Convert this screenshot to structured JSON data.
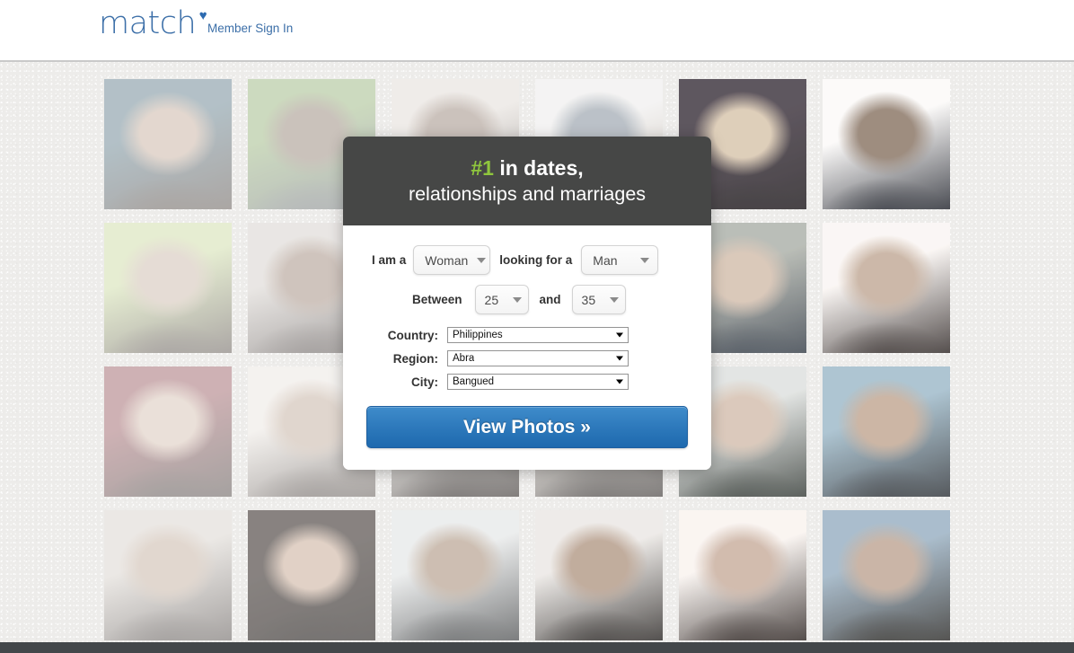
{
  "header": {
    "logo_text": "match",
    "logo_heart_icon": "heart-icon",
    "signin_label": "Member Sign In"
  },
  "modal": {
    "headline_hash": "#1",
    "headline_rest": " in dates,",
    "headline_line2": "relationships and marriages",
    "accent_color": "#8fc63d",
    "header_bg": "#464746",
    "gender_row": {
      "label_i_am_a": "I am a",
      "self_value": "Woman",
      "label_looking_for_a": "looking for a",
      "target_value": "Man"
    },
    "age_row": {
      "label_between": "Between",
      "age_min": "25",
      "label_and": "and",
      "age_max": "35"
    },
    "location": [
      {
        "label": "Country:",
        "value": "Philippines"
      },
      {
        "label": "Region:",
        "value": "Abra"
      },
      {
        "label": "City:",
        "value": "Bangued"
      }
    ],
    "cta_label": "View Photos »",
    "cta_color": "#2f7bbd"
  },
  "photo_grid": {
    "columns": 6,
    "rows": 4,
    "tiles": [
      {
        "name": "photo-r1c1",
        "wash": "wash-hi",
        "c1": "#2f6e8e",
        "c2": "#c89c7c",
        "c3": "#3a2a22"
      },
      {
        "name": "photo-r1c2",
        "wash": "wash-hi",
        "c1": "#6fae3f",
        "c2": "#8a6a52",
        "c3": "#4b5a62"
      },
      {
        "name": "photo-r1c3",
        "wash": "wash-hi",
        "c1": "#d8cfc6",
        "c2": "#8d6a54",
        "c3": "#3b2a22"
      },
      {
        "name": "photo-r1c4",
        "wash": "wash-hi",
        "c1": "#dfe0e2",
        "c2": "#4f6d8c",
        "c3": "#93724f"
      },
      {
        "name": "photo-r1c5",
        "wash": "wash-lo",
        "c1": "#3a2b3d",
        "c2": "#d8b98d",
        "c3": "#1d161c"
      },
      {
        "name": "photo-r1c6",
        "wash": "wash-lo",
        "c1": "#efeeec",
        "c2": "#8c6a4d",
        "c3": "#1b2230"
      },
      {
        "name": "photo-r2c1",
        "wash": "wash-hi",
        "c1": "#b6d96a",
        "c2": "#caa98c",
        "c3": "#3c2e26"
      },
      {
        "name": "photo-r2c2",
        "wash": "wash-hi",
        "c1": "#c9c2bb",
        "c2": "#9a6f55",
        "c3": "#2f2220"
      },
      {
        "name": "photo-r2c3",
        "wash": "wash-md",
        "c1": "#cfc6bd",
        "c2": "#a07a5e",
        "c3": "#332522"
      },
      {
        "name": "photo-r2c4",
        "wash": "wash-md",
        "c1": "#cbd2d6",
        "c2": "#9b7a5e",
        "c3": "#2a2420"
      },
      {
        "name": "photo-r2c5",
        "wash": "wash-lo",
        "c1": "#9fa89a",
        "c2": "#d5b192",
        "c3": "#2b3b4c"
      },
      {
        "name": "photo-r2c6",
        "wash": "wash-lo",
        "c1": "#efe9e4",
        "c2": "#c59d7c",
        "c3": "#2e2320"
      },
      {
        "name": "photo-r3c1",
        "wash": "wash-hi",
        "c1": "#b03a4a",
        "c2": "#d7b095",
        "c3": "#2b1f1c"
      },
      {
        "name": "photo-r3c2",
        "wash": "wash-hi",
        "c1": "#e3dcd4",
        "c2": "#c09a7c",
        "c3": "#33251f"
      },
      {
        "name": "photo-r3c3",
        "wash": "wash-md",
        "c1": "#dcd6cf",
        "c2": "#b08a6c",
        "c3": "#2d2220"
      },
      {
        "name": "photo-r3c4",
        "wash": "wash-md",
        "c1": "#d9cfc4",
        "c2": "#b7916f",
        "c3": "#2b2220"
      },
      {
        "name": "photo-r3c5",
        "wash": "wash-lo",
        "c1": "#cfd6d2",
        "c2": "#d6b294",
        "c3": "#2d3a32"
      },
      {
        "name": "photo-r3c6",
        "wash": "wash-lo",
        "c1": "#7fb3cf",
        "c2": "#c79a76",
        "c3": "#27313a"
      },
      {
        "name": "photo-r4c1",
        "wash": "wash-hi",
        "c1": "#cfc7bd",
        "c2": "#c29c7d",
        "c3": "#2d2320"
      },
      {
        "name": "photo-r4c2",
        "wash": "wash-md",
        "c1": "#3a2a26",
        "c2": "#d6a88a",
        "c3": "#1d1412"
      },
      {
        "name": "photo-r4c3",
        "wash": "wash-md",
        "c1": "#d6dadd",
        "c2": "#b48a68",
        "c3": "#20242a"
      },
      {
        "name": "photo-r4c4",
        "wash": "wash-lo",
        "c1": "#e0dcd6",
        "c2": "#b98f6e",
        "c3": "#2a2622"
      },
      {
        "name": "photo-r4c5",
        "wash": "wash-lo",
        "c1": "#efe7e0",
        "c2": "#cda184",
        "c3": "#2e211c"
      },
      {
        "name": "photo-r4c6",
        "wash": "wash-lo",
        "c1": "#7fa9c9",
        "c2": "#c39a7b",
        "c3": "#2a2a26"
      }
    ]
  },
  "footer": {
    "bar_color": "#43474a"
  }
}
